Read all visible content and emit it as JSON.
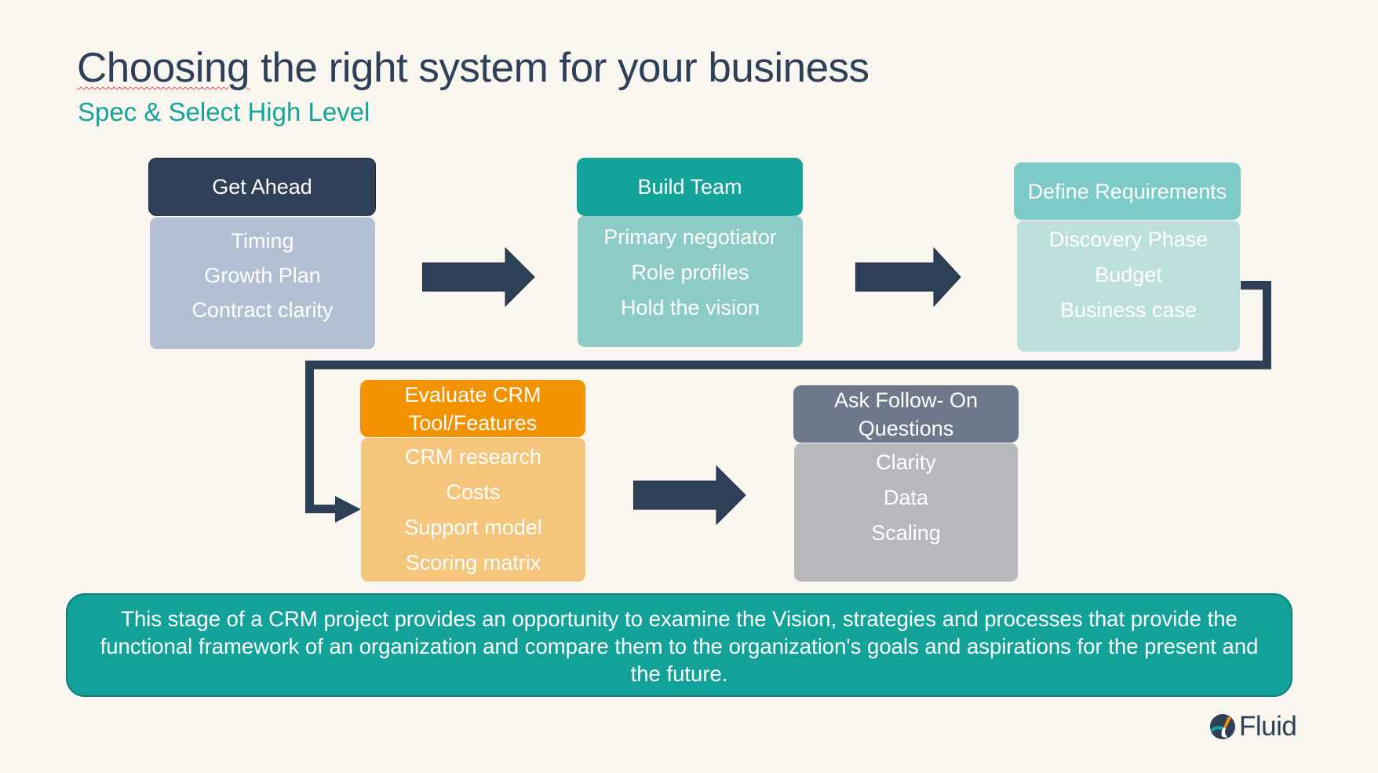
{
  "header": {
    "title_part1": "Choosing",
    "title_part2": " the right system for your business",
    "subtitle": "Spec & Select High Level"
  },
  "colors": {
    "navy": "#2e3f58",
    "teal": "#13a29a",
    "background": "#f9f5ef"
  },
  "stages": [
    {
      "title": "Get Ahead",
      "header_color": "#2e3f58",
      "body_color": "#b3c0d3",
      "items": [
        "Timing",
        "Growth Plan",
        "Contract clarity"
      ]
    },
    {
      "title": "Build Team",
      "header_color": "#13a29a",
      "body_color": "#8ccbc6",
      "items": [
        "Primary negotiator",
        "Role profiles",
        "Hold the vision"
      ]
    },
    {
      "title": "Define Requirements",
      "header_color": "#7ccbc9",
      "body_color": "#bde0dd",
      "items": [
        "Discovery Phase",
        "Budget",
        "Business case"
      ]
    },
    {
      "title": "Evaluate CRM Tool/Features",
      "header_color": "#f29200",
      "body_color": "#f5c57c",
      "items": [
        "CRM research",
        "Costs",
        "Support model",
        "Scoring matrix"
      ]
    },
    {
      "title": "Ask Follow- On Questions",
      "header_color": "#6e788b",
      "body_color": "#b6b8bd",
      "items": [
        "Clarity",
        "Data",
        "Scaling"
      ]
    }
  ],
  "flow_arrows": [
    "right-arrow-icon",
    "right-arrow-icon",
    "elbow-connector-arrow",
    "right-arrow-icon"
  ],
  "summary": {
    "text": "This stage of a CRM project provides an opportunity to examine the Vision,  strategies and processes that provide the functional framework of an organization and compare them to the organization's goals and aspirations for the present and the future."
  },
  "logo": {
    "icon": "fluid-logo-icon",
    "text": "Fluid"
  }
}
